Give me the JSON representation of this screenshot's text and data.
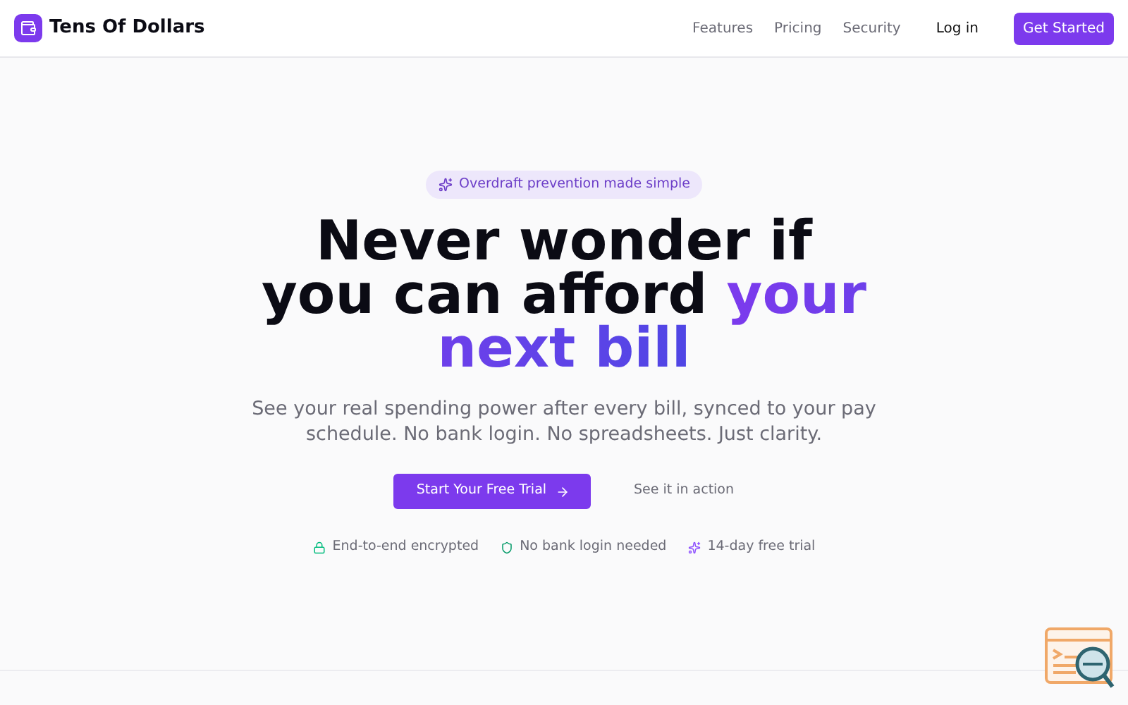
{
  "brand": {
    "name": "Tens Of Dollars"
  },
  "nav": {
    "links": [
      "Features",
      "Pricing",
      "Security"
    ],
    "login": "Log in",
    "cta": "Get Started"
  },
  "hero": {
    "badge": "Overdraft prevention made simple",
    "headline": "Never wonder if you can afford",
    "highlight": "your next bill",
    "subtitle": "See your real spending power after every bill, synced to your pay schedule. No bank login. No spreadsheets. Just clarity.",
    "primary_button": "Start Your Free Trial",
    "secondary_link": "See it in action",
    "features": [
      {
        "kind": "lock",
        "label": "End-to-end encrypted"
      },
      {
        "kind": "shield",
        "label": "No bank login needed"
      },
      {
        "kind": "sparkle",
        "label": "14-day free trial"
      }
    ]
  }
}
